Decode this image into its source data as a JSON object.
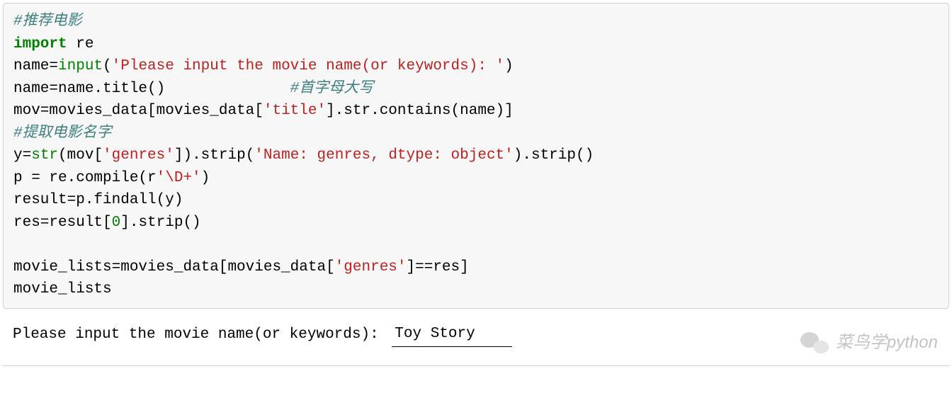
{
  "code": {
    "line1_comment": "#推荐电影",
    "line2_keyword": "import",
    "line2_module": " re",
    "line3_a": "name=",
    "line3_builtin": "input",
    "line3_b": "(",
    "line3_string": "'Please input the movie name(or keywords): '",
    "line3_c": ")",
    "line4_a": "name=name.title()              ",
    "line4_comment": "#首字母大写",
    "line5_a": "mov=movies_data[movies_data[",
    "line5_string": "'title'",
    "line5_b": "].str.contains(name)]",
    "line6_comment": "#提取电影名字",
    "line7_a": "y=",
    "line7_builtin": "str",
    "line7_b": "(mov[",
    "line7_string1": "'genres'",
    "line7_c": "]).strip(",
    "line7_string2": "'Name: genres, dtype: object'",
    "line7_d": ").strip()",
    "line8_a": "p = re.compile(",
    "line8_prefix": "r",
    "line8_string": "'\\D+'",
    "line8_b": ")",
    "line9": "result=p.findall(y)",
    "line10_a": "res=result[",
    "line10_num": "0",
    "line10_b": "].strip()",
    "line11": "",
    "line12_a": "movie_lists=movies_data[movies_data[",
    "line12_string": "'genres'",
    "line12_b": "]==res]",
    "line13": "movie_lists"
  },
  "prompt": {
    "label": "Please input the movie name(or keywords): ",
    "input_value": "Toy Story"
  },
  "watermark": {
    "text": "菜鸟学python"
  }
}
